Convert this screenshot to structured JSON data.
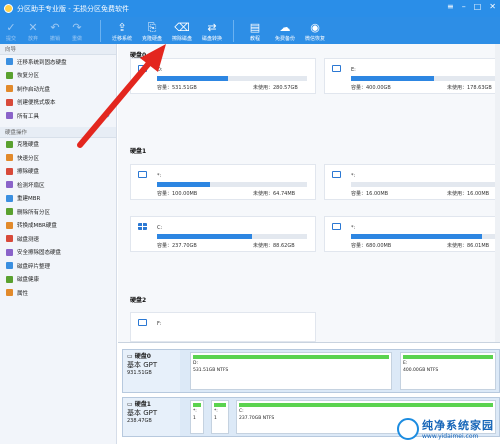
{
  "title": {
    "text": "分区助手专业版 - 无损分区免费软件"
  },
  "toolbar": [
    {
      "label": "提交",
      "icon": "✓",
      "disabled": true
    },
    {
      "label": "放弃",
      "icon": "✕",
      "disabled": true
    },
    {
      "label": "撤销",
      "icon": "↶",
      "disabled": true
    },
    {
      "label": "重做",
      "icon": "↷",
      "disabled": true
    },
    {
      "label": "迁移系统",
      "icon": "⇪",
      "disabled": false
    },
    {
      "label": "克隆硬盘",
      "icon": "⎘",
      "disabled": false
    },
    {
      "label": "擦除磁盘",
      "icon": "⌫",
      "disabled": false
    },
    {
      "label": "磁盘转换",
      "icon": "⇄",
      "disabled": false
    },
    {
      "label": "教程",
      "icon": "▤",
      "disabled": false
    },
    {
      "label": "免费备份",
      "icon": "☁",
      "disabled": false
    },
    {
      "label": "微信恢复",
      "icon": "◉",
      "disabled": false
    }
  ],
  "sidebar": {
    "wizard_header": "向导",
    "wizard_items": [
      "迁移系统到固态硬盘",
      "恢复分区",
      "制作启动光盘",
      "创建便携式版本",
      "所有工具"
    ],
    "ops_header": "硬盘操作",
    "ops_items": [
      "克隆硬盘",
      "快速分区",
      "擦除硬盘",
      "检测坏扇区",
      "重建MBR",
      "删除所有分区",
      "转换成MBR硬盘",
      "磁盘测速",
      "安全擦除固态硬盘",
      "磁盘碎片整理",
      "磁盘健康",
      "属性"
    ]
  },
  "disks": [
    {
      "header": "硬盘0",
      "partitions": [
        {
          "name": "D:",
          "capacity": "容量：531.51GB",
          "free": "未使用：280.57GB",
          "used": 0.47,
          "icon": "drive"
        },
        {
          "name": "E:",
          "capacity": "容量：400.00GB",
          "free": "未使用：178.63GB",
          "used": 0.55,
          "icon": "drive"
        }
      ]
    },
    {
      "header": "硬盘1",
      "partitions": [
        {
          "name": "*:",
          "capacity": "容量：100.00MB",
          "free": "未使用：64.74MB",
          "used": 0.35,
          "icon": "drive"
        },
        {
          "name": "*:",
          "capacity": "容量：16.00MB",
          "free": "未使用：16.00MB",
          "used": 0.0,
          "icon": "drive"
        },
        {
          "name": "C:",
          "capacity": "容量：237.70GB",
          "free": "未使用：88.62GB",
          "used": 0.63,
          "icon": "windows"
        },
        {
          "name": "*:",
          "capacity": "容量：680.00MB",
          "free": "未使用：86.01MB",
          "used": 0.87,
          "icon": "drive"
        }
      ]
    },
    {
      "header": "硬盘2",
      "partitions": [
        {
          "name": "F:",
          "capacity": "",
          "free": "",
          "used": 0.0,
          "icon": "drive"
        }
      ]
    }
  ],
  "disk_map": [
    {
      "label": "硬盘0",
      "type": "基本 GPT",
      "size": "931.51GB",
      "segments": [
        {
          "name": "D:",
          "info": "531.51GB NTFS"
        },
        {
          "name": "E:",
          "info": "400.00GB NTFS"
        }
      ]
    },
    {
      "label": "硬盘1",
      "type": "基本 GPT",
      "size": "238.47GB",
      "segments": [
        {
          "name": "*:",
          "info": "1"
        },
        {
          "name": "*:",
          "info": "1"
        },
        {
          "name": "C:",
          "info": "237.70GB NTFS"
        }
      ]
    }
  ],
  "watermark": {
    "line1": "纯净系统家园",
    "line2": "www.yidaimei.com"
  }
}
